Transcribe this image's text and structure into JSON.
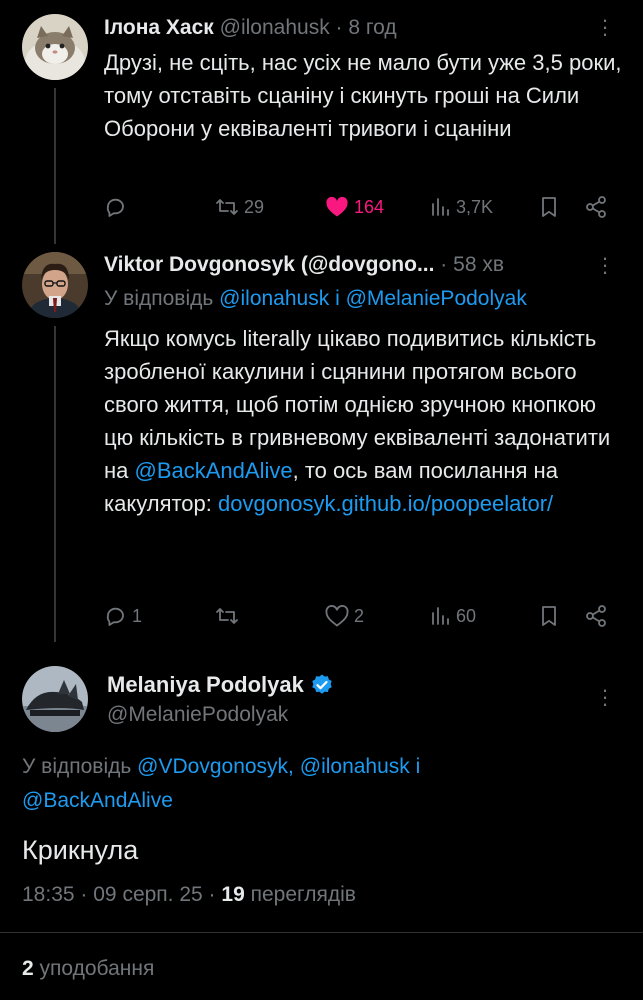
{
  "tweet1": {
    "author_name": "Ілона Хаск",
    "handle": "@ilonahusk",
    "separator": "·",
    "time": "8 год",
    "text": "Друзі, не сціть, нас усіх не мало бути уже 3,5 роки, тому отставіть сцаніну і скинуть гроші на Сили Оборони у еквіваленті тривоги і сцаніни",
    "retweets": "29",
    "likes": "164",
    "views": "3,7K"
  },
  "tweet2": {
    "author_name": "Viktor Dovgonosyk (@dovgono...",
    "separator": "·",
    "time": "58 хв",
    "reply_prefix": "У відповідь",
    "reply_to_1": "@ilonahusk",
    "reply_and": "і",
    "reply_to_2": "@MelaniePodolyak",
    "text_part1": "Якщо комусь literally цікаво подивитись кількість зробленої какулини і сцянини протягом всього свого життя, щоб потім однією зручною кнопкою цю кількість в гривневому еквіваленті задонатити на",
    "mention": "@BackAndAlive",
    "text_part2": ", то ось вам посилання на какулятор:",
    "url": "dovgonosyk.github.io/poopeelator/",
    "replies": "1",
    "likes": "2",
    "views": "60"
  },
  "tweet3": {
    "author_name": "Melaniya Podolyak",
    "handle": "@MelaniePodolyak",
    "reply_prefix": "У відповідь",
    "reply_to_1": "@VDovgonosyk,",
    "reply_to_2": "@ilonahusk",
    "reply_and": "і",
    "reply_to_3": "@BackAndAlive",
    "text": "Крикнула",
    "time": "18:35",
    "sep1": "·",
    "date": "09 серп. 25",
    "sep2": "·",
    "views_count": "19",
    "views_label": "переглядів",
    "likes_count": "2",
    "likes_label": "уподобання"
  },
  "colors": {
    "background": "#000000",
    "text": "#e7e9ea",
    "muted": "#71767b",
    "link": "#1d9bf0",
    "like_active": "#f91880",
    "verified": "#1d9bf0"
  },
  "icons": [
    "reply-icon",
    "retweet-icon",
    "heart-icon",
    "views-icon",
    "bookmark-icon",
    "share-icon",
    "more-icon",
    "verified-icon"
  ]
}
